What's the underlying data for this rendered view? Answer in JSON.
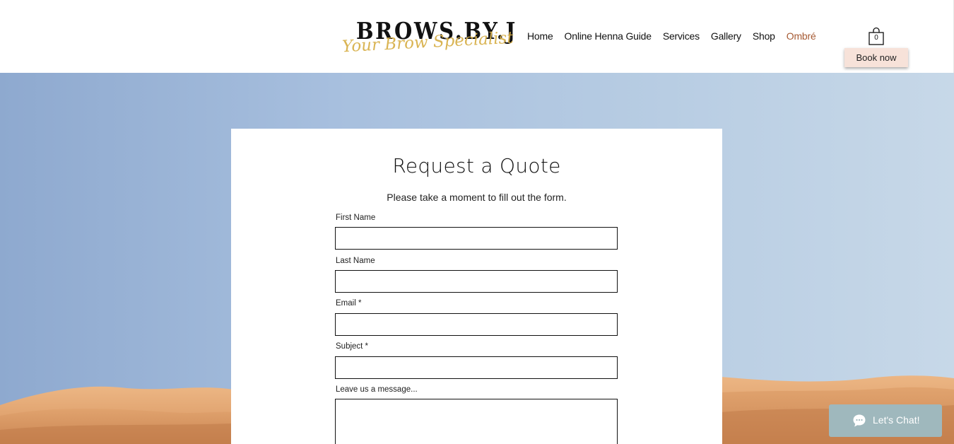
{
  "header": {
    "logo_text": "BROWS.BY.J",
    "logo_tagline": "Your Brow Specialist",
    "nav": [
      {
        "label": "Home"
      },
      {
        "label": "Online Henna Guide"
      },
      {
        "label": "Services"
      },
      {
        "label": "Gallery"
      },
      {
        "label": "Shop"
      },
      {
        "label": "Ombré"
      }
    ],
    "cart_count": "0",
    "cart_icon": "shopping-bag-icon",
    "book_label": "Book now"
  },
  "form": {
    "title": "Request a Quote",
    "subtitle": "Please take a moment to fill out the form.",
    "fields": [
      {
        "label": "First Name",
        "value": ""
      },
      {
        "label": "Last Name",
        "value": ""
      },
      {
        "label": "Email *",
        "value": ""
      },
      {
        "label": "Subject *",
        "value": ""
      },
      {
        "label": "Leave us a message...",
        "value": ""
      }
    ]
  },
  "chat": {
    "label": "Let's Chat!",
    "icon": "chat-bubble-icon"
  },
  "colors": {
    "active_nav": "#a65a33",
    "book_button_bg": "#f7e2d9",
    "chat_bg": "#9fb8bd",
    "logo_script": "#d8b04a"
  }
}
